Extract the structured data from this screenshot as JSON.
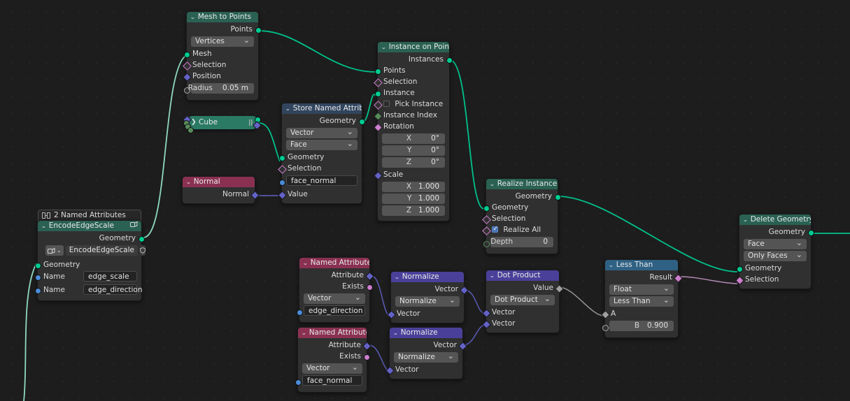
{
  "app": {
    "name": "Blender Geometry Nodes Editor",
    "background": "#1d1d1d"
  },
  "colors": {
    "geometry_socket": "#00cc92",
    "vector_socket": "#6363c7",
    "boolean_socket": "#cc7ecc",
    "float_socket": "#a1a1a1",
    "string_socket": "#4a8cd8",
    "integer_socket": "#598c5c",
    "geometry_header": "#2a6152",
    "vector_header": "#4a4099",
    "input_header": "#8a3152",
    "compare_header": "#2f6184",
    "group_header": "#31455e",
    "geometry_wire": "#00c28a",
    "vector_wire": "#6363c7",
    "boolean_wire": "#b58cb5",
    "float_wire": "#9a9a9a"
  },
  "nodes": {
    "mesh_to_points": {
      "title": "Mesh to Points",
      "outputs": [
        "Points"
      ],
      "mode": "Vertices",
      "inputs": [
        "Mesh",
        "Selection",
        "Position"
      ],
      "radius_label": "Radius",
      "radius_value": "0.05 m"
    },
    "instance_on_points": {
      "title": "Instance on Points",
      "outputs": [
        "Instances"
      ],
      "inputs": [
        "Points",
        "Selection",
        "Instance",
        "Pick Instance",
        "Instance Index",
        "Rotation"
      ],
      "pick_instance_checked": false,
      "rotation": {
        "label": "Rotation",
        "x_label": "X",
        "y_label": "Y",
        "z_label": "Z",
        "x": "0°",
        "y": "0°",
        "z": "0°"
      },
      "scale": {
        "label": "Scale",
        "x_label": "X",
        "y_label": "Y",
        "z_label": "Z",
        "x": "1.000",
        "y": "1.000",
        "z": "1.000"
      }
    },
    "store_named_attribute": {
      "title": "Store Named Attrib...",
      "outputs": [
        "Geometry"
      ],
      "data_type": "Vector",
      "domain": "Face",
      "inputs": [
        "Geometry",
        "Selection"
      ],
      "name_value": "face_normal",
      "value_label": "Value"
    },
    "cube": {
      "title": "Cube",
      "collapsed": true
    },
    "normal": {
      "title": "Normal",
      "outputs": [
        "Normal"
      ]
    },
    "named_attributes_group": {
      "frame_label": "2 Named Attributes",
      "title": "EncodeEdgeScale",
      "outputs": [
        "Geometry"
      ],
      "group_selector": "EncodeEdgeScale",
      "inputs": [
        "Geometry"
      ],
      "fields": [
        {
          "label": "Name",
          "value": "edge_scale"
        },
        {
          "label": "Name",
          "value": "edge_direction"
        }
      ]
    },
    "realize_instances": {
      "title": "Realize Instances",
      "outputs": [
        "Geometry"
      ],
      "inputs": [
        "Geometry",
        "Selection"
      ],
      "realize_all_label": "Realize All",
      "realize_all_checked": true,
      "depth_label": "Depth",
      "depth_value": "0"
    },
    "delete_geometry": {
      "title": "Delete Geometry",
      "outputs": [
        "Geometry"
      ],
      "domain": "Face",
      "mode": "Only Faces",
      "inputs": [
        "Geometry",
        "Selection"
      ]
    },
    "named_attribute_1": {
      "title": "Named Attribute",
      "outputs": [
        "Attribute",
        "Exists"
      ],
      "data_type": "Vector",
      "name_value": "edge_direction"
    },
    "named_attribute_2": {
      "title": "Named Attribute",
      "outputs": [
        "Attribute",
        "Exists"
      ],
      "data_type": "Vector",
      "name_value": "face_normal"
    },
    "normalize_1": {
      "title": "Normalize",
      "outputs": [
        "Vector"
      ],
      "operation": "Normalize",
      "inputs": [
        "Vector"
      ]
    },
    "normalize_2": {
      "title": "Normalize",
      "outputs": [
        "Vector"
      ],
      "operation": "Normalize",
      "inputs": [
        "Vector"
      ]
    },
    "dot_product": {
      "title": "Dot Product",
      "outputs": [
        "Value"
      ],
      "operation": "Dot Product",
      "inputs": [
        "Vector",
        "Vector"
      ]
    },
    "less_than": {
      "title": "Less Than",
      "outputs": [
        "Result"
      ],
      "data_type": "Float",
      "operation": "Less Than",
      "inputs": [
        {
          "label": "A"
        }
      ],
      "b_label": "B",
      "b_value": "0.900"
    }
  }
}
